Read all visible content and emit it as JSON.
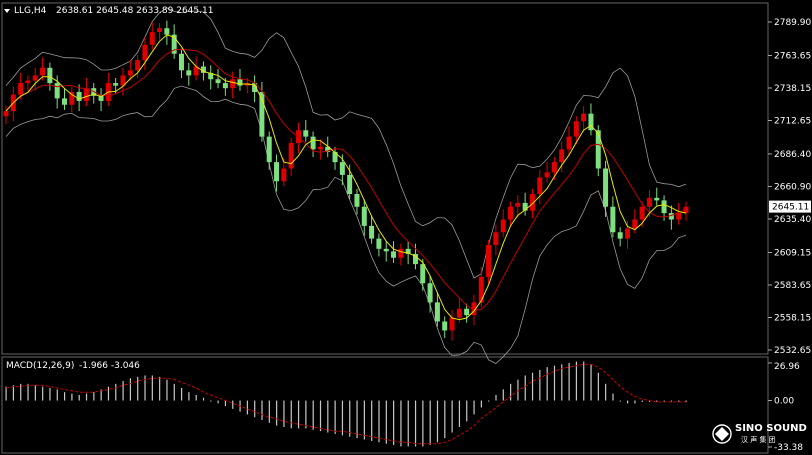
{
  "header": {
    "symbol": "LLG,H4",
    "ohlc": "2638.61 2645.48 2633.89 2645.11"
  },
  "macd_header": {
    "label": "MACD(12,26,9)",
    "values": "-1.966 -3.046"
  },
  "logo": {
    "line1": "SINO SOUND",
    "line2": "汉 声 集 团"
  },
  "colors": {
    "background": "#000000",
    "bull": "#e00000",
    "bear": "#7fe07f",
    "bands": "#9a9a9a",
    "ma": "#e8e800",
    "mid": "#c00000",
    "macd_hist": "#c8c8c8",
    "macd_signal": "#d00000"
  },
  "chart_data": {
    "type": "candlestick",
    "title": "LLG,H4",
    "ylim": [
      2532.65,
      2789.9
    ],
    "y_ticks": [
      "2789.90",
      "2763.65",
      "2738.15",
      "2712.65",
      "2686.40",
      "2660.90",
      "2635.40",
      "2609.15",
      "2583.65",
      "2558.15",
      "2532.65"
    ],
    "last_price": "2645.11",
    "closes": [
      2720,
      2733,
      2742,
      2744,
      2748,
      2754,
      2742,
      2730,
      2725,
      2735,
      2728,
      2738,
      2732,
      2728,
      2742,
      2740,
      2748,
      2752,
      2760,
      2772,
      2782,
      2785,
      2780,
      2765,
      2752,
      2748,
      2755,
      2750,
      2745,
      2742,
      2738,
      2745,
      2740,
      2742,
      2735,
      2700,
      2680,
      2665,
      2675,
      2695,
      2705,
      2700,
      2690,
      2692,
      2688,
      2680,
      2670,
      2655,
      2645,
      2630,
      2620,
      2612,
      2610,
      2605,
      2612,
      2608,
      2600,
      2585,
      2570,
      2555,
      2548,
      2558,
      2565,
      2560,
      2570,
      2590,
      2615,
      2625,
      2635,
      2645,
      2648,
      2642,
      2655,
      2668,
      2672,
      2680,
      2690,
      2700,
      2712,
      2718,
      2705,
      2675,
      2645,
      2625,
      2620,
      2628,
      2635,
      2645,
      2652,
      2650,
      2640,
      2635,
      2640,
      2645
    ],
    "macd_hist": [
      10,
      11,
      12,
      12,
      11,
      10,
      9,
      8,
      6,
      5,
      4,
      5,
      6,
      8,
      10,
      12,
      14,
      16,
      17,
      18,
      18,
      17,
      15,
      12,
      9,
      6,
      4,
      2,
      0,
      -2,
      -4,
      -6,
      -8,
      -10,
      -12,
      -14,
      -16,
      -18,
      -19,
      -20,
      -20,
      -20,
      -21,
      -22,
      -23,
      -24,
      -25,
      -26,
      -27,
      -28,
      -29,
      -30,
      -31,
      -32,
      -33,
      -33,
      -33,
      -33,
      -32,
      -30,
      -27,
      -23,
      -19,
      -15,
      -10,
      -5,
      0,
      4,
      8,
      12,
      15,
      18,
      20,
      22,
      24,
      25,
      26,
      27,
      28,
      28,
      26,
      20,
      12,
      5,
      0,
      -2,
      -2,
      -1,
      -1,
      -1,
      0,
      0,
      -1,
      -1
    ],
    "macd_signal": [
      9,
      10,
      10,
      11,
      11,
      11,
      10,
      9,
      8,
      7,
      6,
      6,
      6,
      7,
      8,
      9,
      11,
      12,
      14,
      15,
      16,
      16,
      16,
      15,
      13,
      11,
      9,
      6,
      4,
      2,
      0,
      -2,
      -4,
      -6,
      -8,
      -10,
      -12,
      -13,
      -15,
      -16,
      -17,
      -18,
      -19,
      -20,
      -21,
      -22,
      -22,
      -23,
      -24,
      -25,
      -26,
      -27,
      -28,
      -29,
      -30,
      -30,
      -31,
      -31,
      -31,
      -31,
      -30,
      -28,
      -25,
      -22,
      -18,
      -13,
      -9,
      -5,
      -1,
      3,
      7,
      10,
      14,
      16,
      19,
      21,
      23,
      24,
      25,
      26,
      26,
      24,
      20,
      15,
      10,
      6,
      3,
      1,
      0,
      -1,
      -1,
      -1,
      -1,
      -1
    ],
    "macd_ylim": [
      -33.38,
      26.96
    ],
    "macd_ticks": [
      "26.96",
      "0.00",
      "-33.38"
    ]
  }
}
